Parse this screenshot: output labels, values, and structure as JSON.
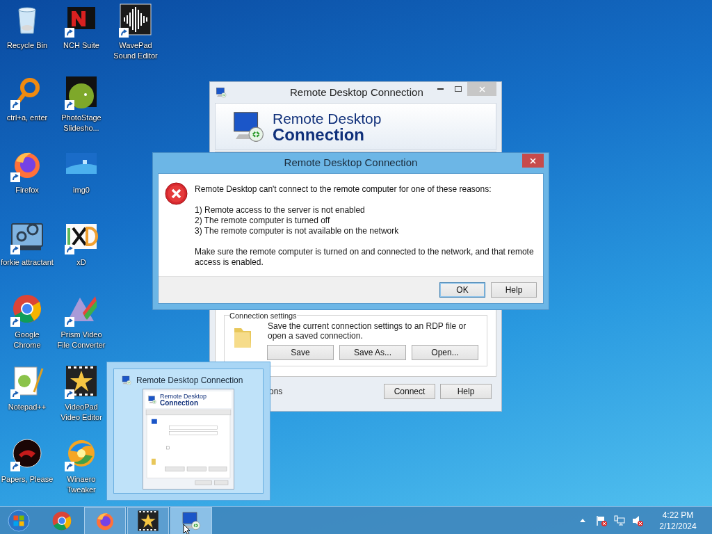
{
  "desktop_icons": [
    [
      {
        "label": "Recycle Bin",
        "kind": "bin",
        "shortcut": false
      },
      {
        "label": "NCH Suite",
        "kind": "nch",
        "shortcut": true
      },
      {
        "label": "WavePad Sound Editor",
        "kind": "wave",
        "shortcut": true
      }
    ],
    [
      {
        "label": "ctrl+a, enter",
        "kind": "ring",
        "shortcut": true
      },
      {
        "label": "PhotoStage Slidesho...",
        "kind": "photostage",
        "shortcut": true
      }
    ],
    [
      {
        "label": "Firefox",
        "kind": "firefox",
        "shortcut": true
      },
      {
        "label": "img0",
        "kind": "image",
        "shortcut": false
      }
    ],
    [
      {
        "label": "forkie attractant",
        "kind": "gear",
        "shortcut": true
      },
      {
        "label": "xD",
        "kind": "hxd",
        "shortcut": true
      }
    ],
    [
      {
        "label": "Google Chrome",
        "kind": "chrome",
        "shortcut": true
      },
      {
        "label": "Prism Video File Converter",
        "kind": "prism",
        "shortcut": true
      }
    ],
    [
      {
        "label": "Notepad++",
        "kind": "notepad",
        "shortcut": true
      },
      {
        "label": "VideoPad Video Editor",
        "kind": "videopad",
        "shortcut": true
      }
    ],
    [
      {
        "label": "Papers, Please",
        "kind": "papers",
        "shortcut": true
      },
      {
        "label": "Winaero Tweaker",
        "kind": "winaero",
        "shortcut": true
      }
    ]
  ],
  "main_window": {
    "title": "Remote Desktop Connection",
    "banner": [
      "Remote Desktop",
      "Connection"
    ],
    "connection_settings": {
      "legend": "Connection settings",
      "description": "Save the current connection settings to an RDP file or open a saved connection.",
      "buttons": [
        "Save",
        "Save As...",
        "Open..."
      ]
    },
    "options_fragment": "ons",
    "buttons": [
      "Connect",
      "Help"
    ]
  },
  "dialog": {
    "title": "Remote Desktop Connection",
    "message": "Remote Desktop can't connect to the remote computer for one of these reasons:",
    "reasons": [
      "1) Remote access to the server is not enabled",
      "2) The remote computer is turned off",
      "3) The remote computer is not available on the network"
    ],
    "note": "Make sure the remote computer is turned on and connected to the network, and that remote access is enabled.",
    "buttons": [
      {
        "label": "OK",
        "default": true
      },
      {
        "label": "Help",
        "default": false
      }
    ]
  },
  "thumbnail": {
    "title": "Remote Desktop Connection",
    "preview_heading": [
      "Remote Desktop",
      "Connection"
    ]
  },
  "taskbar": {
    "items": [
      {
        "kind": "chrome",
        "running": false,
        "selected": false
      },
      {
        "kind": "firefox",
        "running": true,
        "selected": false
      },
      {
        "kind": "videopad",
        "running": true,
        "selected": false
      },
      {
        "kind": "rdc",
        "running": true,
        "selected": true
      }
    ],
    "clock": {
      "time": "4:22 PM",
      "date": "2/12/2024"
    }
  }
}
